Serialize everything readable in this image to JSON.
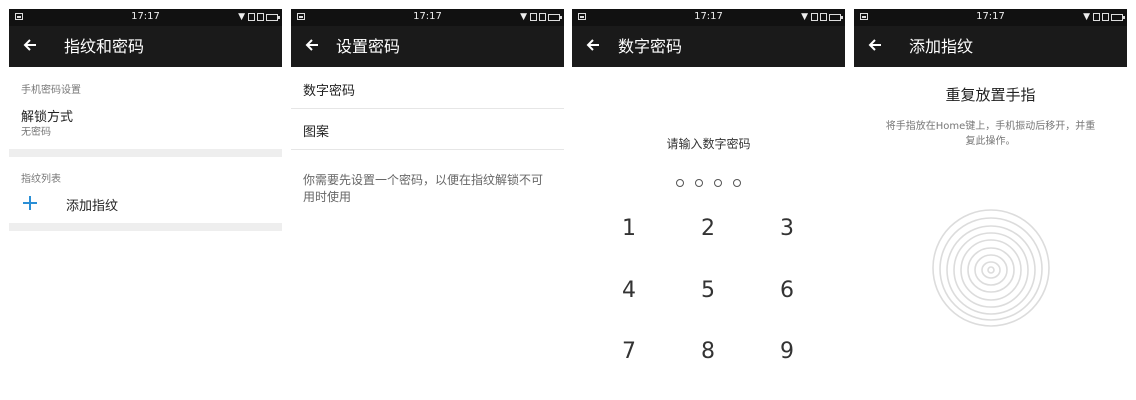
{
  "status_bar": {
    "time": "17:17"
  },
  "screen1": {
    "title": "指纹和密码",
    "section_password": "手机密码设置",
    "unlock_method_label": "解锁方式",
    "unlock_method_value": "无密码",
    "section_fingerprint": "指纹列表",
    "add_fingerprint_label": "添加指纹"
  },
  "screen2": {
    "title": "设置密码",
    "option_numeric": "数字密码",
    "option_pattern": "图案",
    "hint": "你需要先设置一个密码，以便在指纹解锁不可用时使用"
  },
  "screen3": {
    "title": "数字密码",
    "prompt": "请输入数字密码",
    "keys": [
      "1",
      "2",
      "3",
      "4",
      "5",
      "6",
      "7",
      "8",
      "9"
    ]
  },
  "screen4": {
    "title": "添加指纹",
    "heading": "重复放置手指",
    "description": "将手指放在Home键上，手机振动后移开，并重复此操作。"
  },
  "icons": {
    "back": "back-arrow-icon",
    "add": "plus-icon",
    "fingerprint": "fingerprint-icon"
  },
  "colors": {
    "titlebar": "#1a1a1a",
    "accent": "#2a8fd6"
  }
}
